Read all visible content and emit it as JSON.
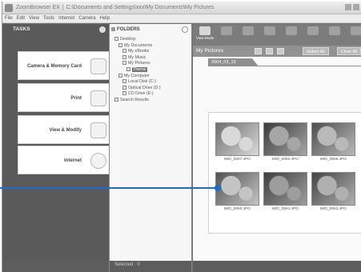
{
  "window": {
    "app_title": "ZoomBrowser EX",
    "path_title": "C:\\Documents and Settings\\xxx\\My Documents\\My Pictures"
  },
  "menubar": [
    "File",
    "Edit",
    "View",
    "Tools",
    "Internet",
    "Camera",
    "Help"
  ],
  "tasks": {
    "header": "TASKS",
    "items": [
      {
        "label": "Camera & Memory Card",
        "icon": "camera-icon"
      },
      {
        "label": "Print",
        "icon": "printer-icon"
      },
      {
        "label": "View & Modify",
        "icon": "view-modify-icon"
      },
      {
        "label": "Internet",
        "icon": "globe-icon"
      }
    ]
  },
  "folders": {
    "header": "FOLDERS",
    "tree": [
      {
        "label": "Desktop",
        "depth": 0
      },
      {
        "label": "My Documents",
        "depth": 1
      },
      {
        "label": "My eBooks",
        "depth": 2
      },
      {
        "label": "My Music",
        "depth": 2
      },
      {
        "label": "My Pictures",
        "depth": 2
      },
      {
        "label": "Theme",
        "depth": 3,
        "selected": true
      },
      {
        "label": "My Computer",
        "depth": 1
      },
      {
        "label": "Local Disk (C:)",
        "depth": 2
      },
      {
        "label": "Optical Drive (D:)",
        "depth": 2
      },
      {
        "label": "CD Drive (E:)",
        "depth": 2
      },
      {
        "label": "Search Results",
        "depth": 0
      }
    ]
  },
  "toolbar": {
    "buttons": [
      {
        "label": "View Mode",
        "active": true
      },
      {
        "label": "",
        "active": false
      },
      {
        "label": "",
        "active": false
      },
      {
        "label": "",
        "active": false
      },
      {
        "label": "",
        "active": false
      },
      {
        "label": "",
        "active": false
      },
      {
        "label": "",
        "active": false
      },
      {
        "label": "",
        "active": false
      }
    ]
  },
  "navbar": {
    "path": "My Pictures",
    "select_all": "Select All",
    "clear_all": "Clear All"
  },
  "content": {
    "date_tab": "2004_03_13",
    "thumbnails": [
      {
        "name": "IMG_0057.JPG",
        "palette": [
          "#6f6f6f",
          "#d9d9d9"
        ]
      },
      {
        "name": "IMG_0050.JPG",
        "palette": [
          "#3a3a3a",
          "#a6a6a6"
        ]
      },
      {
        "name": "IMG_0055.JPG",
        "palette": [
          "#4d4d4d",
          "#b9b9b9"
        ]
      },
      {
        "name": "IMG_0060.JPG",
        "palette": [
          "#525252",
          "#c4c4c4"
        ]
      },
      {
        "name": "IMG_0061.JPG",
        "palette": [
          "#3f3f3f",
          "#9d9d9d"
        ]
      },
      {
        "name": "IMG_0063.JPG",
        "palette": [
          "#444444",
          "#b0b0b0"
        ]
      }
    ]
  },
  "status": {
    "selected": "Selected : 0"
  },
  "colors": {
    "leader": "#1c6bd0"
  }
}
